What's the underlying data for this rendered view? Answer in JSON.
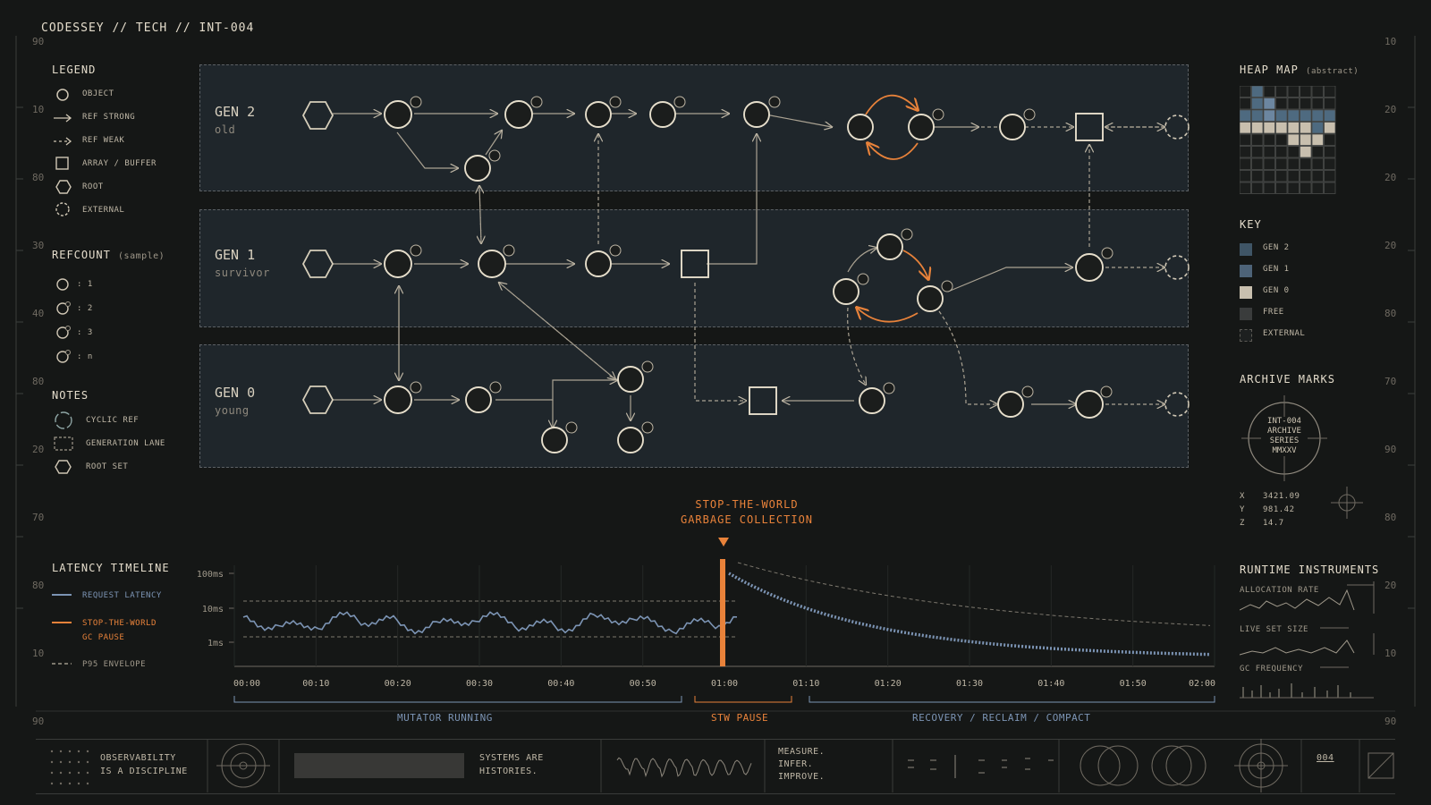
{
  "header": {
    "title": "CODESSEY // TECH // INT-004"
  },
  "legend": {
    "title": "LEGEND",
    "items": [
      {
        "icon": "circle-icon",
        "label": "OBJECT"
      },
      {
        "icon": "arrow-right-icon",
        "label": "REF STRONG"
      },
      {
        "icon": "arrow-dashed-icon",
        "label": "REF WEAK"
      },
      {
        "icon": "square-icon",
        "label": "ARRAY / BUFFER"
      },
      {
        "icon": "hexagon-icon",
        "label": "ROOT"
      },
      {
        "icon": "dashed-circle-icon",
        "label": "EXTERNAL"
      }
    ]
  },
  "refcount": {
    "title": "REFCOUNT",
    "subtitle": "(sample)",
    "items": [
      ": 1",
      ": 2",
      ": 3",
      ": n"
    ]
  },
  "notes": {
    "title": "NOTES",
    "items": [
      {
        "icon": "cycle-icon",
        "label": "CYCLIC REF"
      },
      {
        "icon": "dashed-square-icon",
        "label": "GENERATION LANE"
      },
      {
        "icon": "hexagon-icon",
        "label": "ROOT SET"
      }
    ]
  },
  "lanes": [
    {
      "title": "GEN 2",
      "subtitle": "old"
    },
    {
      "title": "GEN 1",
      "subtitle": "survivor"
    },
    {
      "title": "GEN 0",
      "subtitle": "young"
    }
  ],
  "heap_map": {
    "title": "HEAP MAP",
    "subtitle": "(abstract)"
  },
  "key": {
    "title": "KEY",
    "items": [
      {
        "label": "GEN 2",
        "color": "#3f5566"
      },
      {
        "label": "GEN 1",
        "color": "#4d6378"
      },
      {
        "label": "GEN 0",
        "color": "#c8bfae"
      },
      {
        "label": "FREE",
        "color": "#3a3c3c"
      },
      {
        "label": "EXTERNAL",
        "color": "#1d2020"
      }
    ]
  },
  "archive": {
    "title": "ARCHIVE MARKS",
    "seal_lines": [
      "INT-004",
      "ARCHIVE",
      "SERIES",
      "MMXXV"
    ],
    "coords": [
      {
        "axis": "X",
        "value": "3421.09"
      },
      {
        "axis": "Y",
        "value": "981.42"
      },
      {
        "axis": "Z",
        "value": "14.7"
      }
    ]
  },
  "stw": {
    "line1": "STOP-THE-WORLD",
    "line2": "GARBAGE COLLECTION"
  },
  "latency": {
    "title": "LATENCY TIMELINE",
    "legend": [
      {
        "label": "REQUEST LATENCY",
        "color": "#7c94b4"
      },
      {
        "label": "STOP-THE-WORLD",
        "label2": "GC PAUSE",
        "color": "#e8823a"
      },
      {
        "label": "P95 ENVELOPE",
        "color": "#9f988a"
      }
    ],
    "phases": [
      "MUTATOR RUNNING",
      "STW PAUSE",
      "RECOVERY / RECLAIM / COMPACT"
    ]
  },
  "chart_data": {
    "type": "line",
    "title": "",
    "x_ticks": [
      "00:00",
      "00:10",
      "00:20",
      "00:30",
      "00:40",
      "00:50",
      "01:00",
      "01:10",
      "01:20",
      "01:30",
      "01:40",
      "01:50",
      "02:00"
    ],
    "y_ticks": [
      "100ms",
      "10ms",
      "1ms"
    ],
    "y_scale": "log",
    "ylim": [
      "1ms",
      "100ms"
    ],
    "series": [
      {
        "name": "REQUEST LATENCY",
        "x_range": [
          "00:00",
          "00:57"
        ],
        "level": "~10ms",
        "style": "solid"
      },
      {
        "name": "STOP-THE-WORLD GC PAUSE",
        "x": "01:00",
        "value": "100ms",
        "style": "vertical-bar"
      },
      {
        "name": "P95 ENVELOPE",
        "style": "dashed"
      }
    ]
  },
  "instruments": {
    "title": "RUNTIME INSTRUMENTS",
    "items": [
      "ALLOCATION RATE",
      "LIVE SET SIZE",
      "GC FREQUENCY"
    ]
  },
  "footer": {
    "cell1": [
      "OBSERVABILITY",
      "IS A DISCIPLINE"
    ],
    "cell2": [
      "SYSTEMS ARE",
      "HISTORIES."
    ],
    "cell3": [
      "MEASURE.",
      "INFER.",
      "IMPROVE."
    ],
    "page": "004"
  },
  "rulers": {
    "left": [
      "90",
      "10",
      "80",
      "30",
      "40",
      "80",
      "20",
      "70",
      "80",
      "10",
      "90"
    ],
    "right": [
      "10",
      "20",
      "20",
      "20",
      "80",
      "70",
      "90",
      "80",
      "20",
      "10",
      "90"
    ]
  }
}
